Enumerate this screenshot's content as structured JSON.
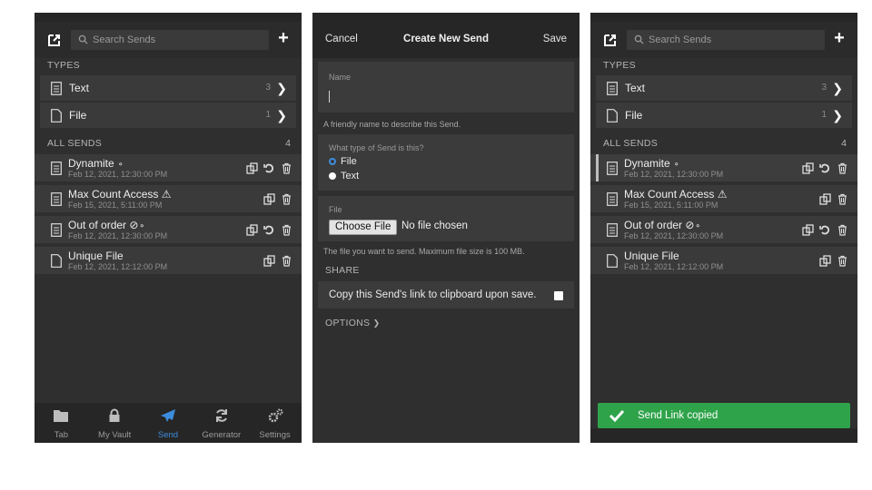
{
  "list": {
    "search_placeholder": "Search Sends",
    "types_heading": "TYPES",
    "types": [
      {
        "label": "Text",
        "count": "3"
      },
      {
        "label": "File",
        "count": "1"
      }
    ],
    "all_heading": "ALL SENDS",
    "all_count": "4",
    "sends": [
      {
        "name": "Dynamite",
        "date": "Feb 12, 2021, 12:30:00 PM",
        "kind": "text"
      },
      {
        "name": "Max Count Access",
        "date": "Feb 15, 2021, 5:11:00 PM",
        "kind": "text"
      },
      {
        "name": "Out of order",
        "date": "Feb 12, 2021, 12:30:00 PM",
        "kind": "text"
      },
      {
        "name": "Unique File",
        "date": "Feb 12, 2021, 12:12:00 PM",
        "kind": "file"
      }
    ]
  },
  "tabs": [
    {
      "label": "Tab",
      "icon": "folder-icon"
    },
    {
      "label": "My Vault",
      "icon": "lock-icon"
    },
    {
      "label": "Send",
      "icon": "paper-plane-icon"
    },
    {
      "label": "Generator",
      "icon": "refresh-icon"
    },
    {
      "label": "Settings",
      "icon": "cogs-icon"
    }
  ],
  "create": {
    "cancel": "Cancel",
    "title": "Create New Send",
    "save": "Save",
    "name_label": "Name",
    "name_hint": "A friendly name to describe this Send.",
    "type_question": "What type of Send is this?",
    "type_options": [
      "File",
      "Text"
    ],
    "file_label": "File",
    "choose_file": "Choose File",
    "no_file": "No file chosen",
    "file_hint": "The file you want to send. Maximum file size is 100 MB.",
    "share_heading": "SHARE",
    "copy_link": "Copy this Send's link to clipboard upon save.",
    "options_heading": "OPTIONS"
  },
  "toast": {
    "message": "Send Link copied"
  },
  "colors": {
    "accent": "#3c8dde",
    "success": "#2fa34a",
    "brand": "#c33aa4"
  }
}
